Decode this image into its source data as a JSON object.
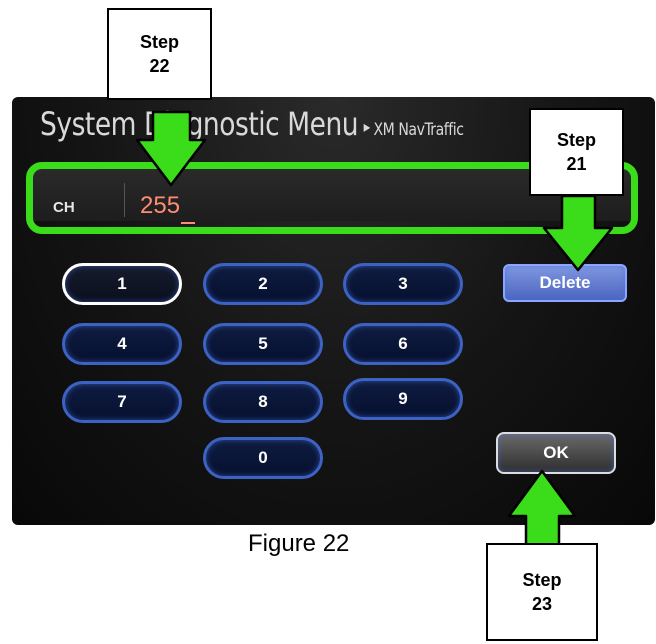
{
  "screen": {
    "title": "System Diagnostic Menu",
    "crumb_separator": "▸",
    "crumb": "XM NavTraffic",
    "channel_label": "CH",
    "channel_value": "255",
    "keys": [
      "1",
      "2",
      "3",
      "4",
      "5",
      "6",
      "7",
      "8",
      "9",
      "0"
    ],
    "delete_label": "Delete",
    "ok_label": "OK"
  },
  "callouts": {
    "step22": [
      "Step",
      "22"
    ],
    "step21": [
      "Step",
      "21"
    ],
    "step23": [
      "Step",
      "23"
    ]
  },
  "caption": "Figure 22",
  "colors": {
    "highlight_green": "#3bdc1a",
    "key_border": "#3c63c4",
    "channel_value": "#ff8c73"
  }
}
